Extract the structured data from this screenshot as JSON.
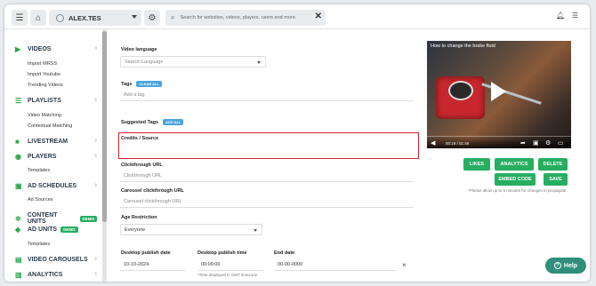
{
  "topbar": {
    "account_name": "ALEX.TES",
    "search_placeholder": "Search for websites, videos, players, users and more."
  },
  "sidebar": {
    "sections": [
      {
        "label": "VIDEOS",
        "subs": [
          "Import MRSS",
          "Import Youtube",
          "Trending Videos"
        ]
      },
      {
        "label": "PLAYLISTS",
        "subs": [
          "Video Matching",
          "Contextual Matching"
        ]
      },
      {
        "label": "LIVESTREAM",
        "subs": []
      },
      {
        "label": "PLAYERS",
        "subs": [
          "Templates"
        ]
      },
      {
        "label": "AD SCHEDULES",
        "subs": [
          "Ad Sources"
        ]
      },
      {
        "label": "CONTENT UNITS",
        "badge": "DEMO",
        "subs": []
      },
      {
        "label": "AD UNITS",
        "badge": "DEMO",
        "subs": [
          "Templates"
        ]
      },
      {
        "label": "VIDEO CAROUSELS",
        "subs": []
      },
      {
        "label": "ANALYTICS",
        "subs": []
      }
    ]
  },
  "form": {
    "video_language_label": "Video language",
    "video_language_placeholder": "Search Language",
    "tags_label": "Tags",
    "clear_all": "CLEAR ALL",
    "tags_placeholder": "Add a tag",
    "suggested_tags_label": "Suggested Tags",
    "add_all": "ADD ALL",
    "credits_label": "Credits / Source",
    "clickthrough_label": "Clickthrough URL",
    "clickthrough_placeholder": "Clickthrough URL",
    "carousel_label": "Carousel clickthrough URL",
    "carousel_placeholder": "Carousel clickthrough URL",
    "age_label": "Age Restriction",
    "age_value": "Everyone",
    "publish_date_label": "Desktop publish date",
    "publish_date_value": "10-10-2024",
    "publish_time_label": "Desktop publish time",
    "publish_time_value": "00:00:00",
    "tz_note": "*Time displayed in GMT timezone",
    "end_date_label": "End date",
    "end_date_value": "00-00-0000"
  },
  "player": {
    "title": "How to change the brake fluid",
    "time": "00:19 / 01:46"
  },
  "actions": {
    "likes": "LIKES",
    "analytics": "ANALYTICS",
    "delete": "DELETE",
    "embed": "EMBED CODE",
    "save": "SAVE",
    "note": "*Please allow up to 5 minutes for changes to propagate."
  },
  "help": {
    "label": "Help"
  },
  "colors": {
    "accent_green": "#27ae60",
    "highlight_red": "#d9202a",
    "tag_blue": "#4aa3df",
    "help_teal": "#2f8f7a"
  }
}
